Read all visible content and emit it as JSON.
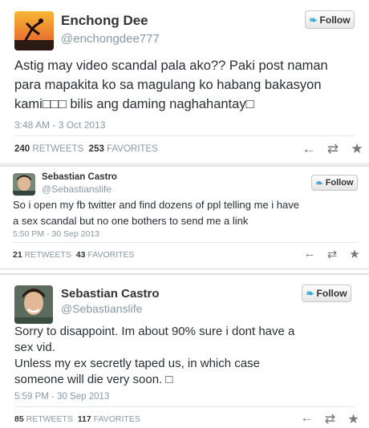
{
  "tweets": [
    {
      "name": "Enchong Dee",
      "handle": "@enchongdee777",
      "follow_label": "Follow",
      "lines": [
        "Astig may video scandal pala ako?? Paki post naman",
        "para mapakita ko sa magulang ko habang bakasyon",
        "kami□□□ bilis ang daming naghahantay□"
      ],
      "time": "3:48 AM - 3 Oct 2013",
      "retweets": "240",
      "retweets_label": "RETWEETS",
      "favorites": "253",
      "favorites_label": "FAVORITES"
    },
    {
      "name": "Sebastian Castro",
      "handle": "@Sebastianslife",
      "follow_label": "Follow",
      "lines": [
        "So i open my fb twitter and find dozens of ppl telling me i have",
        "a sex scandal but no one bothers to send me a link"
      ],
      "time": "5:50 PM - 30 Sep 2013",
      "retweets": "21",
      "retweets_label": "RETWEETS",
      "favorites": "43",
      "favorites_label": "FAVORITES"
    },
    {
      "name": "Sebastian Castro",
      "handle": "@Sebastianslife",
      "follow_label": "Follow",
      "lines": [
        "Sorry to disappoint. Im about 90% sure i dont have a",
        "sex vid.",
        "Unless my ex secretly taped us, in which case",
        "someone will die very soon. □"
      ],
      "time": "5:59 PM - 30 Sep 2013",
      "retweets": "85",
      "retweets_label": "RETWEETS",
      "favorites": "117",
      "favorites_label": "FAVORITES"
    }
  ],
  "icons": {
    "reply": "←",
    "retweet": "⇄",
    "favorite": "★",
    "bird": "❧"
  },
  "colors": {
    "twitter_blue": "#2aa9e0",
    "muted": "#8899a6"
  }
}
